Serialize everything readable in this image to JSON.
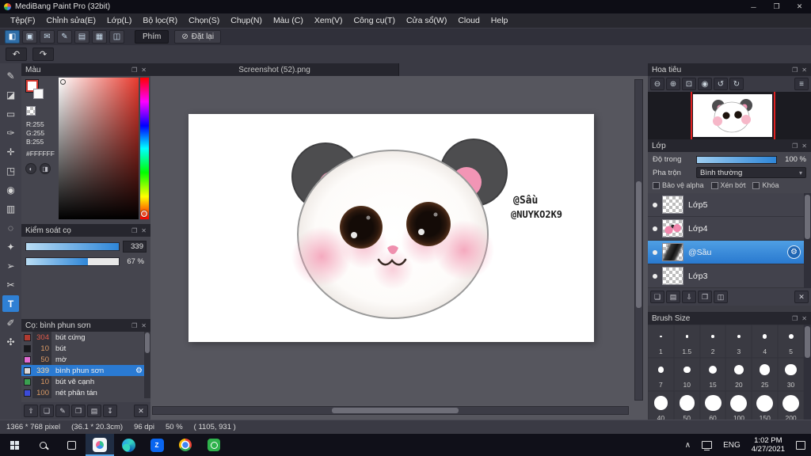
{
  "titlebar": {
    "title": "MediBang Paint Pro (32bit)",
    "controls": [
      {
        "name": "minimize-button",
        "glyph": "─"
      },
      {
        "name": "maximize-button",
        "glyph": "❐"
      },
      {
        "name": "close-button",
        "glyph": "✕"
      }
    ]
  },
  "menubar": {
    "items": [
      "Tệp(F)",
      "Chỉnh sửa(E)",
      "Lớp(L)",
      "Bộ lọc(R)",
      "Chọn(S)",
      "Chụp(N)",
      "Màu (C)",
      "Xem(V)",
      "Công cụ(T)",
      "Cửa sổ(W)",
      "Cloud",
      "Help"
    ]
  },
  "toolbar": {
    "icons": [
      {
        "name": "main-window-icon",
        "glyph": "◧",
        "selected": true
      },
      {
        "name": "save-icon",
        "glyph": "▣"
      },
      {
        "name": "comment-icon",
        "glyph": "✉"
      },
      {
        "name": "brush-panel-icon",
        "glyph": "✎"
      },
      {
        "name": "pages-icon",
        "glyph": "▤"
      },
      {
        "name": "material-grid-icon",
        "glyph": "▦"
      },
      {
        "name": "layout-icon",
        "glyph": "◫"
      }
    ],
    "phim_label": "Phím",
    "reset_glyph": "⊘",
    "reset_label": "Đặt lại"
  },
  "undo": {
    "undo_glyph": "↶",
    "redo_glyph": "↷"
  },
  "panel_icons": [
    {
      "name": "float-panel-icon",
      "glyph": "❐"
    },
    {
      "name": "close-panel-icon",
      "glyph": "✕"
    }
  ],
  "toolstrip": {
    "items": [
      {
        "name": "pen-tool",
        "glyph": "✎"
      },
      {
        "name": "eraser-tool",
        "glyph": "◪"
      },
      {
        "name": "select-tool",
        "glyph": "▭"
      },
      {
        "name": "brush-tool",
        "glyph": "✑"
      },
      {
        "name": "move-tool",
        "glyph": "✛"
      },
      {
        "name": "transform-tool",
        "glyph": "◳"
      },
      {
        "name": "fill-tool",
        "glyph": "◉"
      },
      {
        "name": "gradient-tool",
        "glyph": "▥"
      },
      {
        "name": "lasso-tool",
        "glyph": "◌"
      },
      {
        "name": "wand-tool",
        "glyph": "✦"
      },
      {
        "name": "operation-tool",
        "glyph": "➢"
      },
      {
        "name": "divide-tool",
        "glyph": "✂"
      },
      {
        "name": "text-tool",
        "glyph": "T",
        "selected": true
      },
      {
        "name": "eyedropper-tool",
        "glyph": "✐"
      },
      {
        "name": "hand-tool",
        "glyph": "✣"
      }
    ]
  },
  "color_panel": {
    "title": "Màu",
    "r_label": "R:255",
    "g_label": "G:255",
    "b_label": "B:255",
    "hex_label": "#FFFFFF",
    "current_color": "#FFFFFF",
    "mode_icons": [
      {
        "name": "color-wheel-icon",
        "glyph": "◐"
      },
      {
        "name": "color-slider-icon",
        "glyph": "◨"
      }
    ]
  },
  "brush_control": {
    "title": "Kiểm soát cọ",
    "size_value": "339",
    "size_percent": 100,
    "opacity_value": "67 %",
    "opacity_percent": 67
  },
  "brush_panel": {
    "title": "Cọ: bình phun sơn",
    "items": [
      {
        "name": "brush-item-but-cung",
        "num": "304",
        "label": "bút cứng",
        "swatch": "#b03a30",
        "num_color": "#e05a4a"
      },
      {
        "name": "brush-item-but",
        "num": "10",
        "label": "bút",
        "swatch": "#18181c",
        "num_color": "#dd9c66"
      },
      {
        "name": "brush-item-mo",
        "num": "50",
        "label": "mờ",
        "swatch": "#e26bd2",
        "num_color": "#dd9c66"
      },
      {
        "name": "brush-item-binh-phun-son",
        "num": "339",
        "label": "bình phun sơn",
        "swatch": "#d8d8d8",
        "num_color": "#f0b880",
        "selected": true
      },
      {
        "name": "brush-item-but-ve-canh",
        "num": "10",
        "label": "bút vẽ cạnh",
        "swatch": "#3aa050",
        "num_color": "#dd9c66"
      },
      {
        "name": "brush-item-net-phan-tan",
        "num": "100",
        "label": "nét phân tán",
        "swatch": "#3b4bd8",
        "num_color": "#dd9c66"
      }
    ],
    "gear_glyph": "⚙",
    "footer_icons": [
      {
        "name": "brush-up-icon",
        "glyph": "⇧"
      },
      {
        "name": "new-brush-icon",
        "glyph": "❏"
      },
      {
        "name": "edit-brush-icon",
        "glyph": "✎"
      },
      {
        "name": "copy-brush-icon",
        "glyph": "❐"
      },
      {
        "name": "brush-folder-icon",
        "glyph": "▤"
      },
      {
        "name": "import-brush-icon",
        "glyph": "↧"
      },
      {
        "name": "delete-brush-icon",
        "glyph": "✕"
      }
    ]
  },
  "canvas": {
    "tab_title": "Screenshot (52).png",
    "watermark1": "@Sầu",
    "watermark2": "@NUYKO2K9"
  },
  "navigator": {
    "title": "Hoa tiêu",
    "icons": [
      {
        "name": "zoom-out-icon",
        "glyph": "⊖"
      },
      {
        "name": "zoom-in-icon",
        "glyph": "⊕"
      },
      {
        "name": "zoom-fit-icon",
        "glyph": "⊡"
      },
      {
        "name": "zoom-actual-icon",
        "glyph": "◉"
      },
      {
        "name": "rotate-left-icon",
        "glyph": "↺"
      },
      {
        "name": "rotate-right-icon",
        "glyph": "↻"
      }
    ],
    "menu_glyph": "≡"
  },
  "layer_panel": {
    "title": "Lớp",
    "opacity_label": "Độ trong",
    "opacity_value": "100 %",
    "opacity_percent": 100,
    "blend_label": "Pha trộn",
    "blend_value": "Bình thường",
    "blend_arrow": "▾",
    "protect_alpha_label": "Bảo vệ alpha",
    "clip_label": "Xén bớt",
    "lock_label": "Khóa",
    "gear_glyph": "⚙",
    "layers": [
      {
        "label": "Lớp5",
        "thumb": "blank"
      },
      {
        "label": "Lớp4",
        "thumb": "panda"
      },
      {
        "label": "@Sầu",
        "thumb": "dark",
        "selected": true
      },
      {
        "label": "Lớp3",
        "thumb": "blank"
      }
    ],
    "footer_icons": [
      {
        "name": "new-layer-icon",
        "glyph": "❏"
      },
      {
        "name": "new-folder-icon",
        "glyph": "▤"
      },
      {
        "name": "merge-down-icon",
        "glyph": "⇩"
      },
      {
        "name": "duplicate-layer-icon",
        "glyph": "❐"
      },
      {
        "name": "layer-effect-icon",
        "glyph": "◫"
      },
      {
        "name": "delete-layer-icon",
        "glyph": "✕"
      }
    ]
  },
  "brush_size_panel": {
    "title": "Brush Size",
    "sizes": [
      "1",
      "1.5",
      "2",
      "3",
      "4",
      "5",
      "7",
      "10",
      "15",
      "20",
      "25",
      "30",
      "40",
      "50",
      "60",
      "100",
      "150",
      "200"
    ]
  },
  "statusbar": {
    "resolution": "1366 * 768 pixel",
    "dimensions": "(36.1 * 20.3cm)",
    "dpi": "96 dpi",
    "zoom": "50 %",
    "coords": "( 1105, 931 )"
  },
  "taskbar": {
    "chevron_glyph": "∧",
    "language": "ENG",
    "time": "1:02 PM",
    "date": "4/27/2021"
  }
}
